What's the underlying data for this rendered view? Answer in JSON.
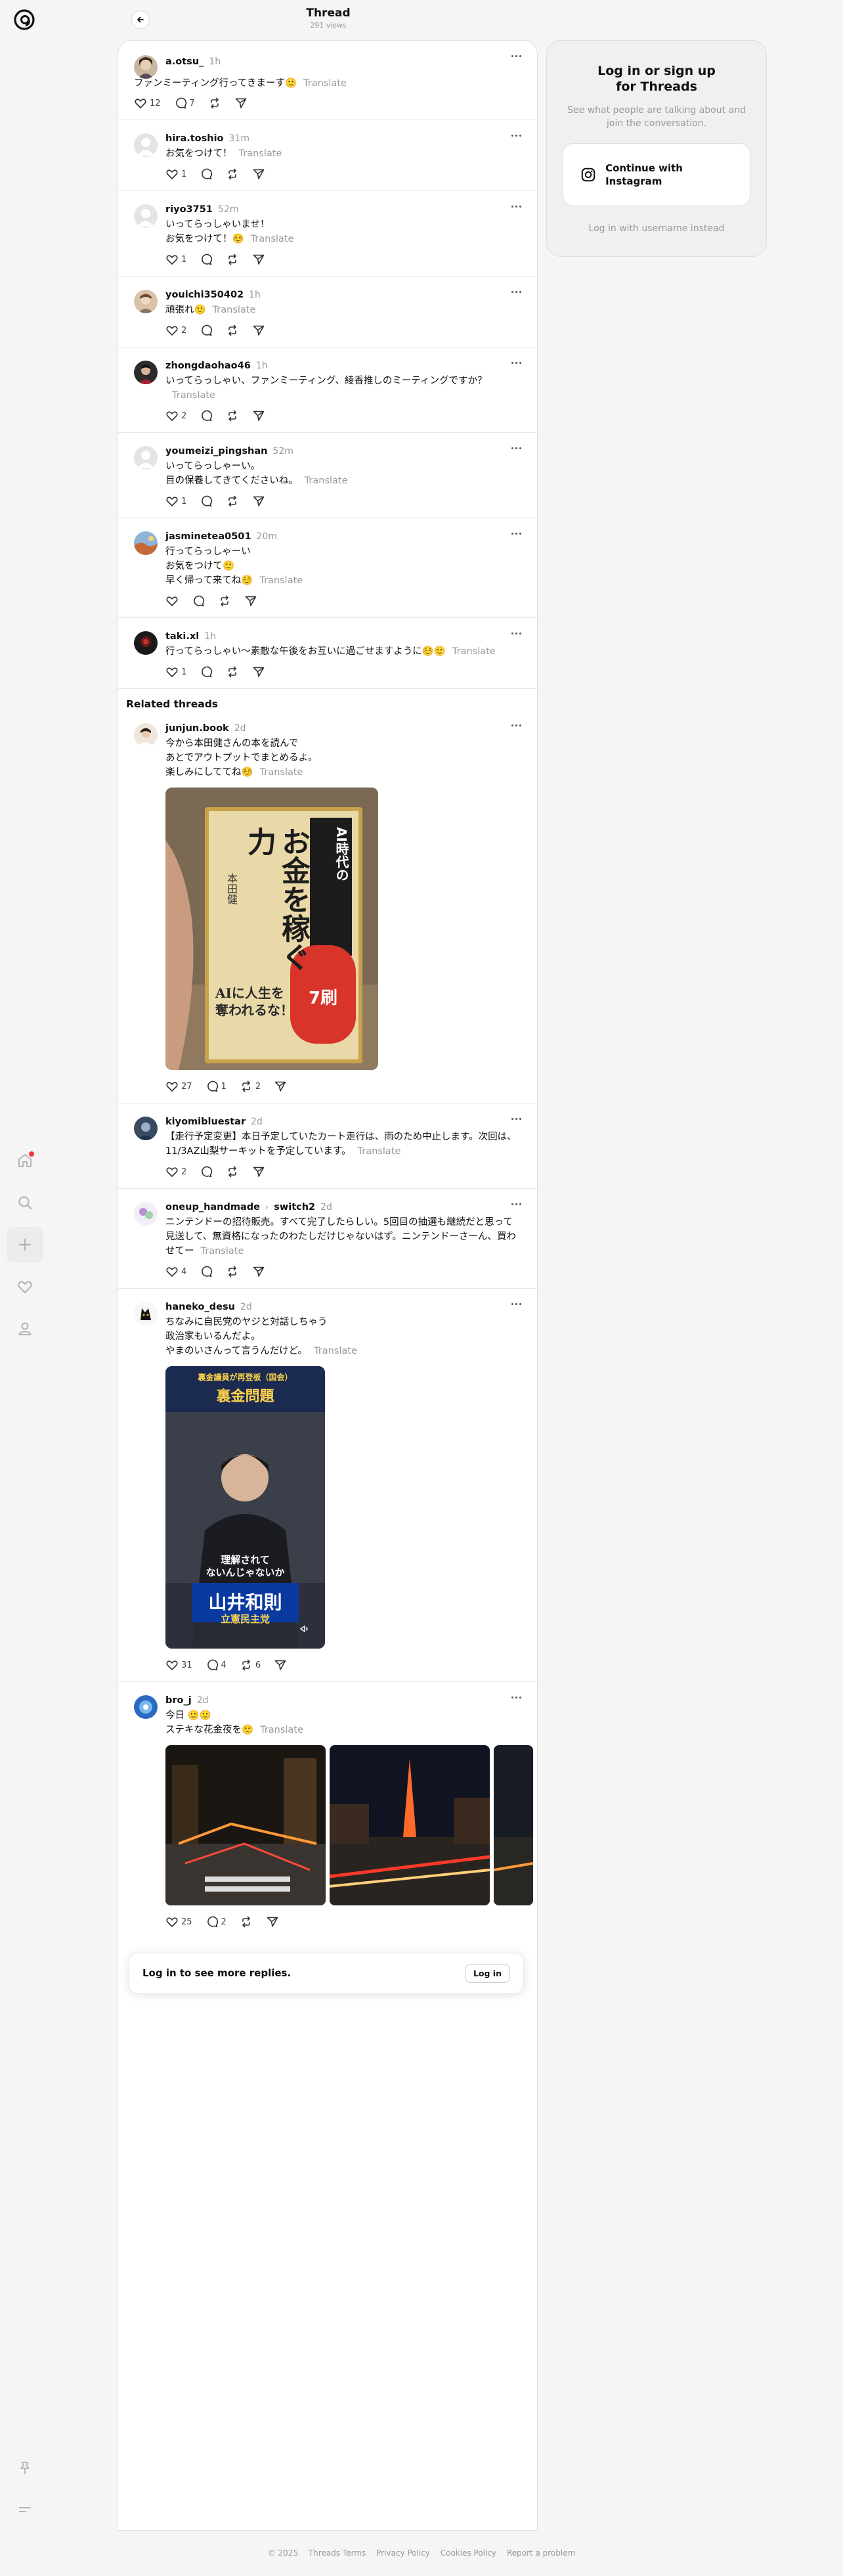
{
  "header": {
    "title": "Thread",
    "views": "291 views"
  },
  "main_post": {
    "username": "a.otsu_",
    "time": "1h",
    "text": "ファンミーティング行ってきまーす🙂",
    "translate": "Translate",
    "likes": "12",
    "replies": "7"
  },
  "replies": [
    {
      "username": "hira.toshio",
      "time": "31m",
      "text": "お気をつけて！",
      "translate": "Translate",
      "likes": "1"
    },
    {
      "username": "riyo3751",
      "time": "52m",
      "text": "いってらっしゃいませ！\nお気をつけて！☺️",
      "translate": "Translate",
      "likes": "1"
    },
    {
      "username": "youichi350402",
      "time": "1h",
      "text": "頑張れ🙂",
      "translate": "Translate",
      "likes": "2"
    },
    {
      "username": "zhongdaohao46",
      "time": "1h",
      "text": "いってらっしゃい、ファンミーティング、綾香推しのミーティングですか？",
      "translate": "Translate",
      "likes": "2"
    },
    {
      "username": "youmeizi_pingshan",
      "time": "52m",
      "text": "いってらっしゃーい。\n目の保養してきてくださいね。",
      "translate": "Translate",
      "likes": "1"
    },
    {
      "username": "jasminetea0501",
      "time": "20m",
      "text": "行ってらっしゃーい\nお気をつけて🙂\n早く帰って来てね☺️",
      "translate": "Translate",
      "likes": ""
    },
    {
      "username": "taki.xl",
      "time": "1h",
      "text": "行ってらっしゃい〜素敵な午後をお互いに過ごせますように☺️🙂",
      "translate": "Translate",
      "likes": "1"
    }
  ],
  "related_title": "Related threads",
  "related": [
    {
      "username": "junjun.book",
      "time": "2d",
      "text": "今から本田健さんの本を読んで\nあとでアウトプットでまとめるよ。\n楽しみにしててね☺️",
      "translate": "Translate",
      "likes": "27",
      "replies": "1",
      "reposts": "2",
      "book": {
        "top": "AI時代の",
        "main": "お金を稼ぐ力",
        "author": "本田健",
        "bottom": "AIに人生を奪われるな！",
        "badge": "7刷"
      }
    },
    {
      "username": "kiyomibluestar",
      "time": "2d",
      "text": "【走行予定変更】本日予定していたカート走行は、雨のため中止します。次回は、11/3AZ山梨サーキットを予定しています。",
      "translate": "Translate",
      "likes": "2",
      "replies": "",
      "reposts": ""
    },
    {
      "username": "oneup_handmade",
      "topic": "switch2",
      "time": "2d",
      "text": "ニンテンドーの招待販売。すべて完了したらしい。5回目の抽選も継続だと思って見送して、無資格になったのわたしだけじゃないはず。ニンテンドーさーん、買わせてー",
      "translate": "Translate",
      "likes": "4",
      "replies": "",
      "reposts": ""
    },
    {
      "username": "haneko_desu",
      "time": "2d",
      "text": "ちなみに自民党のヤジと対話しちゃう\n政治家もいるんだよ。\nやまのいさんって言うんだけど。",
      "translate": "Translate",
      "likes": "31",
      "replies": "4",
      "reposts": "6",
      "video": {
        "caption_top": "裏金議員が再登板（国会）",
        "caption_main": "裏金問題",
        "caption_mid": "理解されて\nないんじゃないか",
        "name": "山井和則",
        "party": "立憲民主党"
      }
    },
    {
      "username": "bro_j",
      "time": "2d",
      "text": "今日 🙂🙂\nステキな花金夜を🙂",
      "translate": "Translate",
      "likes": "25",
      "replies": "2",
      "reposts": ""
    }
  ],
  "login_bar": {
    "text": "Log in to see more replies.",
    "button": "Log in"
  },
  "login_card": {
    "title": "Log in or sign up for Threads",
    "subtitle": "See what people are talking about and join the conversation.",
    "instagram_button": "Continue with Instagram",
    "username_link": "Log in with username instead"
  },
  "footer": {
    "copyright": "© 2025",
    "links": [
      "Threads Terms",
      "Privacy Policy",
      "Cookies Policy",
      "Report a problem"
    ]
  },
  "icons": {
    "logo": "threads-logo-icon",
    "home": "home-icon",
    "search": "search-icon",
    "create": "plus-icon",
    "activity": "heart-icon",
    "profile": "person-icon",
    "pin": "pin-icon",
    "menu": "menu-icon"
  }
}
